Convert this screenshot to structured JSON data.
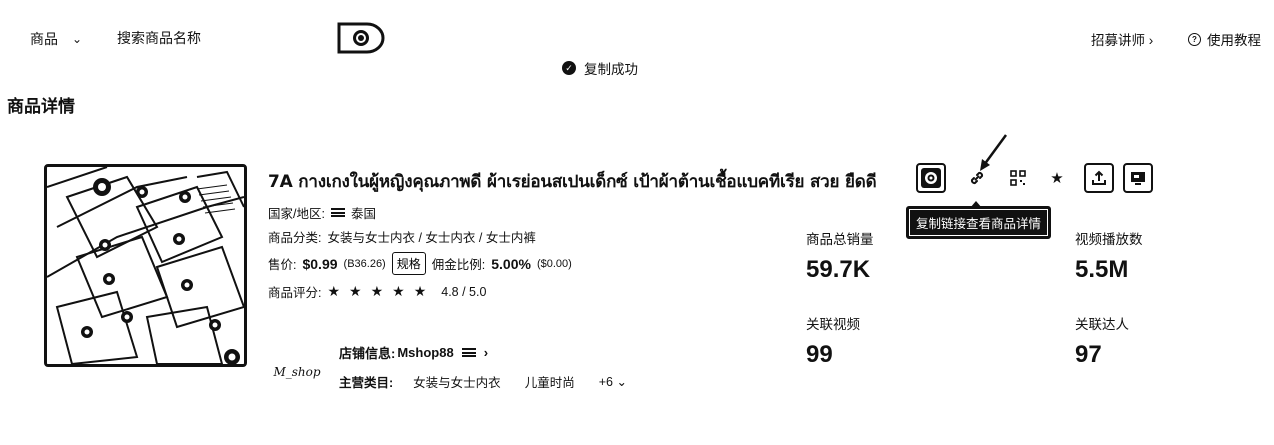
{
  "topbar": {
    "scope_label": "商品",
    "search_placeholder": "搜索商品名称",
    "toast": "复制成功",
    "recruit": "招募讲师",
    "tutorial": "使用教程"
  },
  "page_title": "商品详情",
  "product": {
    "title": "7A กางเกงในผู้หญิงคุณภาพดี ผ้าเรย่อนสเปนเด็กซ์ เป้าผ้าต้านเชื้อแบคทีเรีย สวย ยืดดี",
    "country_label": "国家/地区:",
    "country": "泰国",
    "category_label": "商品分类:",
    "category": "女装与女士内衣 / 女士内衣 / 女士内裤",
    "price_label": "售价:",
    "price": "$0.99",
    "price_local": "(B36.26)",
    "spec_button": "规格",
    "commission_label": "佣金比例:",
    "commission": "5.00%",
    "commission_amount": "($0.00)",
    "rating_label": "商品评分:",
    "rating_stars": "★★★★★",
    "rating": "4.8 / 5.0"
  },
  "shop": {
    "logo_text": "M_shop",
    "info_label": "店铺信息:",
    "name": "Mshop88",
    "main_category_label": "主营类目:",
    "categories": [
      "女装与女士内衣",
      "儿童时尚"
    ],
    "more": "+6"
  },
  "stats": {
    "total_sales_label": "商品总销量",
    "total_sales": "59.7K",
    "video_views_label": "视频播放数",
    "video_views": "5.5M",
    "related_videos_label": "关联视频",
    "related_videos": "99",
    "related_creators_label": "关联达人",
    "related_creators": "97"
  },
  "actions": {
    "tooltip": "复制链接查看商品详情",
    "icons": [
      "tiktok-icon",
      "link-icon",
      "qrcode-icon",
      "star-icon",
      "export-icon",
      "screen-icon"
    ]
  }
}
